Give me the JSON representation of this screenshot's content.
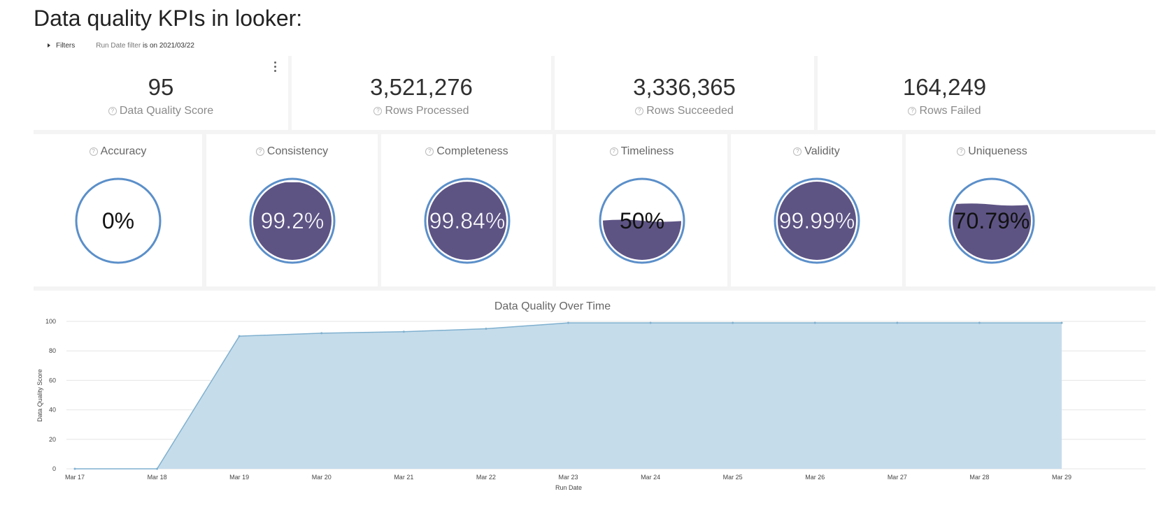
{
  "heading": "Data quality KPIs in looker:",
  "filters": {
    "toggle_label": "Filters",
    "summary_prefix": "Run Date filter",
    "summary_value": "is on 2021/03/22"
  },
  "kpis": [
    {
      "value": "95",
      "label": "Data Quality Score"
    },
    {
      "value": "3,521,276",
      "label": "Rows Processed"
    },
    {
      "value": "3,336,365",
      "label": "Rows Succeeded"
    },
    {
      "value": "164,249",
      "label": "Rows Failed"
    }
  ],
  "gauges": [
    {
      "title": "Accuracy",
      "value_text": "0%",
      "fill": 0.0
    },
    {
      "title": "Consistency",
      "value_text": "99.2%",
      "fill": 0.992
    },
    {
      "title": "Completeness",
      "value_text": "99.84%",
      "fill": 0.9984
    },
    {
      "title": "Timeliness",
      "value_text": "50%",
      "fill": 0.5
    },
    {
      "title": "Validity",
      "value_text": "99.99%",
      "fill": 0.9999
    },
    {
      "title": "Uniqueness",
      "value_text": "70.79%",
      "fill": 0.7079
    }
  ],
  "colors": {
    "gauge_ring": "#5b8fc9",
    "gauge_fill": "#5e5484",
    "area_fill": "#c5dceb",
    "area_line": "#7fb0cf"
  },
  "icons": {
    "info": "info-circle-icon",
    "menu": "kebab-menu-icon",
    "filters": "caret-right-icon"
  },
  "chart_data": {
    "type": "area",
    "title": "Data Quality Over Time",
    "xlabel": "Run Date",
    "ylabel": "Data Quality Score",
    "categories": [
      "Mar 17",
      "Mar 18",
      "Mar 19",
      "Mar 20",
      "Mar 21",
      "Mar 22",
      "Mar 23",
      "Mar 24",
      "Mar 25",
      "Mar 26",
      "Mar 27",
      "Mar 28",
      "Mar 29"
    ],
    "values": [
      0,
      0,
      90,
      92,
      93,
      95,
      99,
      99,
      99,
      99,
      99,
      99,
      99
    ],
    "yticks": [
      0,
      20,
      40,
      60,
      80,
      100
    ],
    "ylim": [
      0,
      100
    ],
    "grid": true
  }
}
